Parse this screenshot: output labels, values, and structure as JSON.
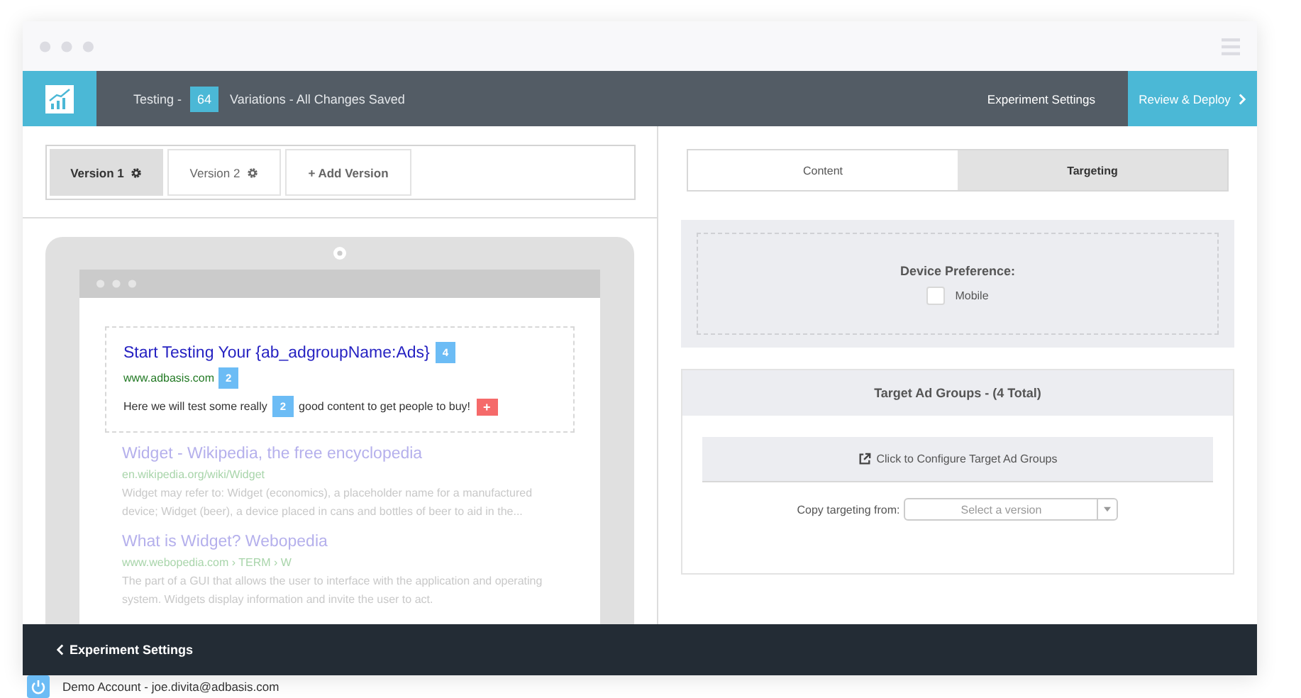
{
  "header": {
    "testing_label": "Testing -",
    "variation_count": "64",
    "status": "Variations - All Changes Saved",
    "settings_link": "Experiment Settings",
    "deploy_button": "Review & Deploy"
  },
  "versions": [
    {
      "label": "Version 1",
      "selected": true
    },
    {
      "label": "Version 2",
      "selected": false
    }
  ],
  "add_version": "+ Add Version",
  "preview": {
    "ad": {
      "headline": "Start Testing Your {ab_adgroupName:Ads}",
      "headline_badge": "4",
      "url": "www.adbasis.com",
      "url_badge": "2",
      "text_before": "Here we will test some really",
      "text_badge": "2",
      "text_after": "good content to get people to buy!",
      "add_button": "+"
    },
    "results": [
      {
        "title": "Widget - Wikipedia, the free encyclopedia",
        "url": "en.wikipedia.org/wiki/Widget",
        "snippet": "Widget may refer to: Widget (economics), a placeholder name for a manufactured device; Widget (beer), a device placed in cans and bottles of beer to aid in the..."
      },
      {
        "title": "What is Widget? Webopedia",
        "url": "www.webopedia.com › TERM › W",
        "snippet": "The part of a GUI that allows the user to interface with the application and operating system. Widgets display information and invite the user to act."
      }
    ]
  },
  "panel_tabs": [
    {
      "label": "Content",
      "selected": false
    },
    {
      "label": "Targeting",
      "selected": true
    }
  ],
  "device_preference": {
    "title": "Device Preference:",
    "options": [
      {
        "label": "Mobile",
        "checked": false
      }
    ]
  },
  "ad_groups": {
    "title": "Target Ad Groups - (4 Total)",
    "configure_button": "Click to Configure Target Ad Groups",
    "copy_label": "Copy targeting from:",
    "select_placeholder": "Select a version"
  },
  "footer": {
    "back_link": "Experiment Settings"
  },
  "account": "Demo Account - joe.divita@adbasis.com"
}
